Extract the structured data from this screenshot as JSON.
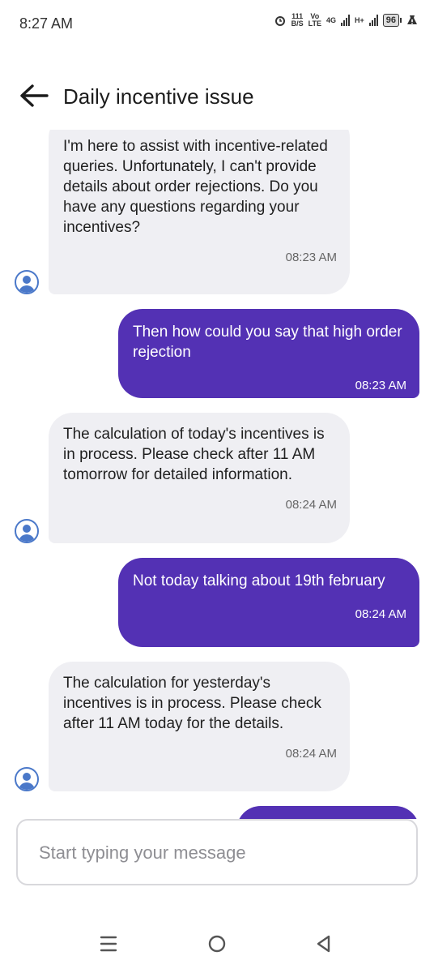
{
  "status_bar": {
    "time": "8:27 AM",
    "net_speed_top": "111",
    "net_speed_bottom": "B/S",
    "volte_top": "Vo",
    "volte_bottom": "LTE",
    "network_1": "4G",
    "network_2": "H+",
    "battery": "96",
    "icons": [
      "alarm-icon",
      "signal-icon",
      "battery-icon",
      "warning-icon"
    ]
  },
  "header": {
    "title": "Daily incentive issue",
    "back_icon": "arrow-left-icon"
  },
  "messages": [
    {
      "from": "bot",
      "text": "I'm here to assist with incentive-related queries. Unfortunately, I can't provide details about order rejections. Do you have any questions regarding your incentives?",
      "time": "08:23 AM"
    },
    {
      "from": "user",
      "text": "Then how could you say that high order rejection",
      "time": "08:23 AM"
    },
    {
      "from": "bot",
      "text": "The calculation of today's incentives is in process. Please check after 11 AM tomorrow for detailed information.",
      "time": "08:24 AM"
    },
    {
      "from": "user",
      "text": "Not today talking about 19th february",
      "time": "08:24 AM"
    },
    {
      "from": "bot",
      "text": "The calculation for yesterday's incentives is in process. Please check after 11 AM today for the details.",
      "time": "08:24 AM"
    }
  ],
  "composer": {
    "placeholder": "Start typing your message",
    "value": ""
  },
  "colors": {
    "user_bubble": "#5331b4",
    "bot_bubble": "#efeff3",
    "avatar": "#4a78c9"
  },
  "nav": {
    "icons": [
      "menu-icon",
      "home-icon",
      "back-triangle-icon"
    ]
  }
}
